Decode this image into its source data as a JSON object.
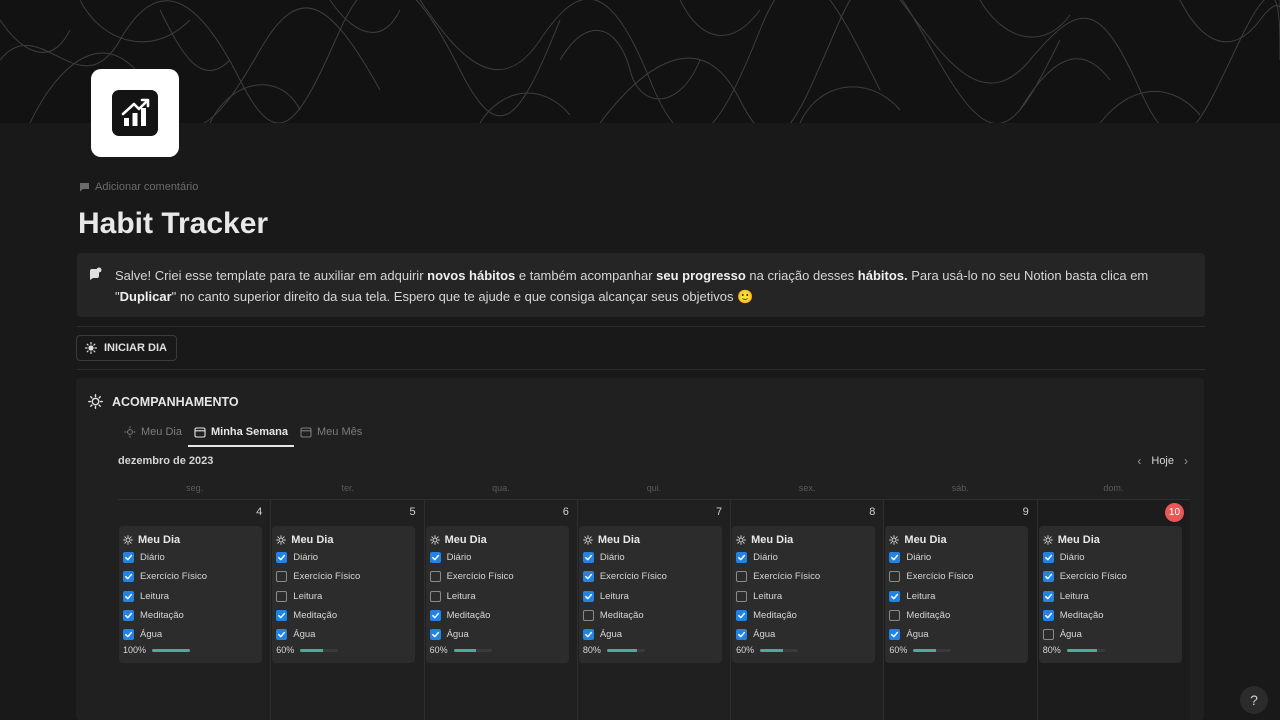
{
  "page": {
    "title": "Habit Tracker",
    "add_comment": "Adicionar comentário"
  },
  "callout": {
    "text_1": "Salve! Criei esse template para te auxiliar em adquirir ",
    "bold_1": "novos hábitos",
    "text_2": " e também acompanhar ",
    "bold_2": "seu progresso",
    "text_3": " na criação desses ",
    "bold_3": "hábitos.",
    "text_4": " Para usá-lo no seu Notion basta clica em \"",
    "bold_4": "Duplicar",
    "text_5": "\" no canto superior direito da sua tela. Espero que te ajude e que consiga alcançar seus objetivos 🙂"
  },
  "start_button": {
    "label": "INICIAR DIA"
  },
  "tracker": {
    "title": "ACOMPANHAMENTO",
    "tabs": [
      {
        "label": "Meu Dia",
        "icon": "sun-icon"
      },
      {
        "label": "Minha Semana",
        "icon": "calendar-icon"
      },
      {
        "label": "Meu Mês",
        "icon": "calendar-icon"
      }
    ],
    "active_tab": 1,
    "month_label": "dezembro de 2023",
    "today_label": "Hoje",
    "weekdays": [
      "seg.",
      "ter.",
      "qua.",
      "qui.",
      "sex.",
      "sáb.",
      "dom."
    ],
    "days": [
      {
        "day": "4",
        "card_title": "Meu Dia",
        "habits": [
          [
            "Diário",
            true
          ],
          [
            "Exercício Físico",
            true
          ],
          [
            "Leitura",
            true
          ],
          [
            "Meditação",
            true
          ],
          [
            "Água",
            true
          ]
        ],
        "progress_label": "100%",
        "progress": 1.0
      },
      {
        "day": "5",
        "card_title": "Meu Dia",
        "habits": [
          [
            "Diário",
            true
          ],
          [
            "Exercício Físico",
            false
          ],
          [
            "Leitura",
            false
          ],
          [
            "Meditação",
            true
          ],
          [
            "Água",
            true
          ]
        ],
        "progress_label": "60%",
        "progress": 0.6
      },
      {
        "day": "6",
        "card_title": "Meu Dia",
        "habits": [
          [
            "Diário",
            true
          ],
          [
            "Exercício Físico",
            false
          ],
          [
            "Leitura",
            false
          ],
          [
            "Meditação",
            true
          ],
          [
            "Água",
            true
          ]
        ],
        "progress_label": "60%",
        "progress": 0.6
      },
      {
        "day": "7",
        "card_title": "Meu Dia",
        "habits": [
          [
            "Diário",
            true
          ],
          [
            "Exercício Físico",
            true
          ],
          [
            "Leitura",
            true
          ],
          [
            "Meditação",
            false
          ],
          [
            "Água",
            true
          ]
        ],
        "progress_label": "80%",
        "progress": 0.8
      },
      {
        "day": "8",
        "card_title": "Meu Dia",
        "habits": [
          [
            "Diário",
            true
          ],
          [
            "Exercício Físico",
            false
          ],
          [
            "Leitura",
            false
          ],
          [
            "Meditação",
            true
          ],
          [
            "Água",
            true
          ]
        ],
        "progress_label": "60%",
        "progress": 0.6
      },
      {
        "day": "9",
        "card_title": "Meu Dia",
        "habits": [
          [
            "Diário",
            true
          ],
          [
            "Exercício Físico",
            false
          ],
          [
            "Leitura",
            true
          ],
          [
            "Meditação",
            false
          ],
          [
            "Água",
            true
          ]
        ],
        "progress_label": "60%",
        "progress": 0.6
      },
      {
        "day": "10",
        "today": true,
        "card_title": "Meu Dia",
        "habits": [
          [
            "Diário",
            true
          ],
          [
            "Exercício Físico",
            true
          ],
          [
            "Leitura",
            true
          ],
          [
            "Meditação",
            true
          ],
          [
            "Água",
            false
          ]
        ],
        "progress_label": "80%",
        "progress": 0.8
      }
    ]
  },
  "help": {
    "label": "?"
  },
  "colors": {
    "checkbox": "#2383e2",
    "progress": "#4dab9a",
    "today_badge": "#eb5757"
  }
}
